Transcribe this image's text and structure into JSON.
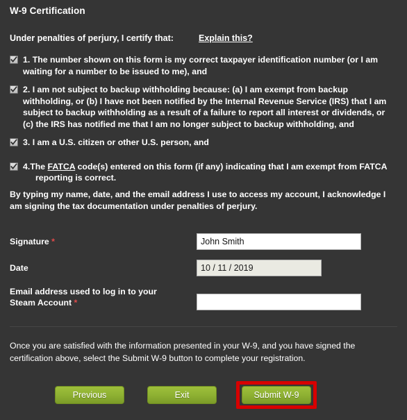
{
  "header": {
    "title": "W-9 Certification"
  },
  "intro": {
    "text": "Under penalties of perjury, I certify that:",
    "explain_link": "Explain this?"
  },
  "certifications": [
    {
      "number": "1.",
      "checked": true,
      "text": "The number shown on this form is my correct taxpayer identification number (or I am waiting for a number to be issued to me), and"
    },
    {
      "number": "2.",
      "checked": true,
      "text": "I am not subject to backup withholding because: (a) I am exempt from backup withholding, or (b) I have not been notified by the Internal Revenue Service (IRS) that I am subject to backup withholding as a result of a failure to report all interest or dividends, or (c) the IRS has notified me that I am no longer subject to backup withholding, and"
    },
    {
      "number": "3.",
      "checked": true,
      "text": "I am a U.S. citizen or other U.S. person, and"
    },
    {
      "number": "4.",
      "checked": true,
      "text_before": "The ",
      "link_text": "FATCA",
      "text_after": " code(s) entered on this form (if any) indicating that I am exempt from FATCA reporting is correct."
    }
  ],
  "acknowledgement": "By typing my name, date, and the email address I use to access my account, I acknowledge I am signing the tax documentation under penalties of perjury.",
  "form": {
    "signature": {
      "label": "Signature",
      "required_mark": "*",
      "value": "John Smith",
      "placeholder": ""
    },
    "date": {
      "label": "Date",
      "required_mark": "",
      "value": "10 / 11 / 2019",
      "placeholder": ""
    },
    "email": {
      "label": "Email address used to log in to your Steam Account",
      "required_mark": "*",
      "value": "",
      "placeholder": ""
    }
  },
  "footer": {
    "instructions": "Once you are satisfied with the information presented in your W-9, and you have signed the certification above, select the Submit W-9 button to complete your registration."
  },
  "buttons": {
    "previous": "Previous",
    "exit": "Exit",
    "submit": "Submit W-9"
  },
  "colors": {
    "background": "#353535",
    "button_green": "#8fb233",
    "highlight_red": "#d70000",
    "required_red": "#e04a4a",
    "field_white": "#ffffff",
    "field_disabled": "#eaeae2"
  }
}
